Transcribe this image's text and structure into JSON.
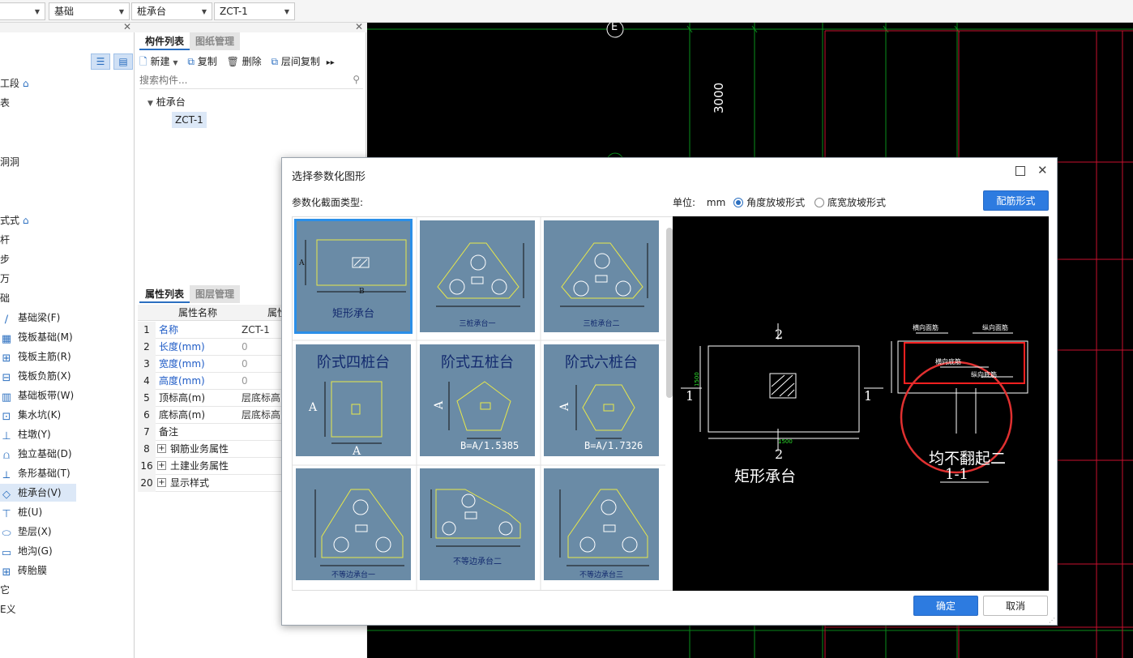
{
  "toolbar": {
    "combo0": "",
    "combo1": "基础",
    "combo2": "桩承台",
    "combo3": "ZCT-1"
  },
  "left_tree": {
    "partial_items": [
      "工段",
      "表",
      "洞洞",
      "式式",
      "杆",
      "步",
      "万",
      "础"
    ],
    "items": [
      {
        "icon": "foundation-beam-icon",
        "label": "基础梁(F)"
      },
      {
        "icon": "raft-foundation-icon",
        "label": "筏板基础(M)"
      },
      {
        "icon": "raft-main-rebar-icon",
        "label": "筏板主筋(R)"
      },
      {
        "icon": "raft-neg-rebar-icon",
        "label": "筏板负筋(X)"
      },
      {
        "icon": "foundation-strip-icon",
        "label": "基础板带(W)"
      },
      {
        "icon": "sump-pit-icon",
        "label": "集水坑(K)"
      },
      {
        "icon": "column-pier-icon",
        "label": "柱墩(Y)"
      },
      {
        "icon": "isolated-foundation-icon",
        "label": "独立基础(D)"
      },
      {
        "icon": "strip-foundation-icon",
        "label": "条形基础(T)"
      },
      {
        "icon": "pile-cap-icon",
        "label": "桩承台(V)"
      },
      {
        "icon": "pile-icon",
        "label": "桩(U)"
      },
      {
        "icon": "cushion-icon",
        "label": "垫层(X)"
      },
      {
        "icon": "trench-icon",
        "label": "地沟(G)"
      },
      {
        "icon": "brick-form-icon",
        "label": "砖胎膜"
      }
    ],
    "tail_items": [
      "它",
      "E义"
    ]
  },
  "component_panel": {
    "tab_active": "构件列表",
    "tab_inactive": "图纸管理",
    "new": "新建",
    "copy": "复制",
    "delete": "删除",
    "floor_copy": "层间复制",
    "search_placeholder": "搜索构件...",
    "tree_root": "桩承台",
    "tree_child": "ZCT-1"
  },
  "props_panel": {
    "tab_active": "属性列表",
    "tab_inactive": "图层管理",
    "col_name": "属性名称",
    "col_value": "属性",
    "rows": [
      {
        "no": "1",
        "name": "名称",
        "value": "ZCT-1",
        "blue": true
      },
      {
        "no": "2",
        "name": "长度(mm)",
        "value": "0",
        "blue": true
      },
      {
        "no": "3",
        "name": "宽度(mm)",
        "value": "0",
        "blue": true
      },
      {
        "no": "4",
        "name": "高度(mm)",
        "value": "0",
        "blue": true
      },
      {
        "no": "5",
        "name": "顶标高(m)",
        "value": "层底标高",
        "blue": false
      },
      {
        "no": "6",
        "name": "底标高(m)",
        "value": "层底标高",
        "blue": false
      },
      {
        "no": "7",
        "name": "备注",
        "value": "",
        "blue": false
      },
      {
        "no": "8",
        "name": "钢筋业务属性",
        "value": "",
        "blue": false,
        "group": true
      },
      {
        "no": "16",
        "name": "土建业务属性",
        "value": "",
        "blue": false,
        "group": true
      },
      {
        "no": "20",
        "name": "显示样式",
        "value": "",
        "blue": false,
        "group": true
      }
    ]
  },
  "cad": {
    "axis_label": "E",
    "dim_label": "3000"
  },
  "dialog": {
    "title": "选择参数化图形",
    "section_label": "参数化截面类型:",
    "unit_label": "单位:",
    "unit_value": "mm",
    "radio1": "角度放坡形式",
    "radio2": "底宽放坡形式",
    "rebar_button": "配筋形式",
    "ok": "确定",
    "cancel": "取消",
    "thumbs": [
      {
        "label": "矩形承台",
        "selected": true
      },
      {
        "label": "三桩承台一"
      },
      {
        "label": "三桩承台二"
      },
      {
        "label": "阶式四桩台",
        "formula": ""
      },
      {
        "label": "阶式五桩台",
        "formula": "B=A/1.5385"
      },
      {
        "label": "阶式六桩台",
        "formula": "B=A/1.7326"
      },
      {
        "label": "不等边承台一"
      },
      {
        "label": "不等边承台二"
      },
      {
        "label": "不等边承台三"
      }
    ],
    "preview": {
      "title": "矩形承台",
      "section_mark": "2",
      "side_mark": "1",
      "dim": "1500",
      "section_title": "1-1",
      "note": "均不翻起二",
      "rebar_x": "横向面筋",
      "rebar_y": "纵向面筋",
      "rebar_x_bot": "横向底筋",
      "rebar_y_bot": "纵向底筋"
    }
  }
}
